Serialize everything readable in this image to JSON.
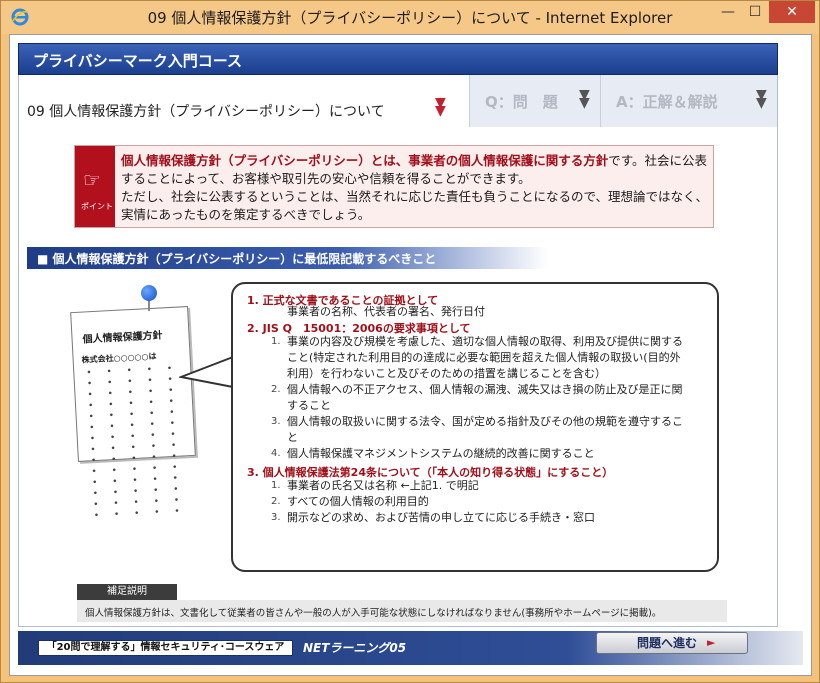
{
  "window": {
    "title": "09 個人情報保護方針（プライバシーポリシー）について - Internet Explorer",
    "minimize": "—",
    "maximize": "☐",
    "close": "✕"
  },
  "course": {
    "title": "プライバシーマーク入門コース"
  },
  "tabs": {
    "main_label": "09 個人情報保護方針（プライバシーポリシー）について",
    "question_label": "Q：問　題",
    "answer_label": "A：正解＆解説"
  },
  "point": {
    "icon_label": "ポイント",
    "highlight": "個人情報保護方針（プライバシーポリシー）とは、事業者の個人情報保護に関する方針",
    "rest1": "です。社会に公表することによって、お客様や取引先の安心や信頼を得ることができます。",
    "rest2": "ただし、社会に公表するということは、当然それに応じた責任も負うことになるので、理想論ではなく、実情にあったものを策定するべきでしょう。"
  },
  "section": {
    "title": "■ 個人情報保護方針（プライバシーポリシー）に最低限記載するべきこと"
  },
  "document": {
    "title": "個人情報保護方針",
    "company": "株式会社○○○○○は",
    "dots": "• • • • • • • • • • • • • • • • • • • • • • • • • • • • • • • • • • • • • • • • • • • • • • • • • • • • • • • • • • • • • • • • • • • • • •"
  },
  "bubble": {
    "h1": "1. 正式な文書であることの証拠として",
    "h1_sub": "事業者の名称、代表者の署名、発行日付",
    "h2": "2. JIS Q　15001：2006の要求事項として",
    "items2": [
      {
        "num": "1.",
        "lines": [
          "事業の内容及び規模を考慮した、適切な個人情報の取得、利用及び提供に関する",
          "こと(特定された利用目的の達成に必要な範囲を超えた個人情報の取扱い(目的外",
          "利用）を行わないこと及びそのための措置を講じることを含む）"
        ]
      },
      {
        "num": "2.",
        "lines": [
          "個人情報への不正アクセス、個人情報の漏洩、滅失又はき損の防止及び是正に関",
          "すること"
        ]
      },
      {
        "num": "3.",
        "lines": [
          "個人情報の取扱いに関する法令、国が定める指針及びその他の規範を遵守するこ",
          "と"
        ]
      },
      {
        "num": "4.",
        "lines": [
          "個人情報保護マネジメントシステムの継続的改善に関すること"
        ]
      }
    ],
    "h3": "3. 個人情報保護法第24条について（「本人の知り得る状態」にすること）",
    "items3": [
      {
        "num": "1.",
        "text": "事業者の氏名又は名称 ←上記1. で明記"
      },
      {
        "num": "2.",
        "text": "すべての個人情報の利用目的"
      },
      {
        "num": "3.",
        "text": "開示などの求め、および苦情の申し立てに応じる手続き・窓口"
      }
    ]
  },
  "supplement": {
    "tag": "補足説明",
    "text": "個人情報保護方針は、文書化して従業者の皆さんや一般の人が入手可能な状態にしなければなりません(事務所やホームページに掲載)。"
  },
  "footer": {
    "box_label": "「20問で理解する」情報セキュリティ･コースウェア",
    "logo": "NETラーニング05",
    "next_button": "問題へ進む",
    "next_arrow": "►"
  },
  "colors": {
    "accent_blue": "#1f3d86",
    "accent_red": "#a1101a",
    "point_bg": "#fdeeee"
  }
}
